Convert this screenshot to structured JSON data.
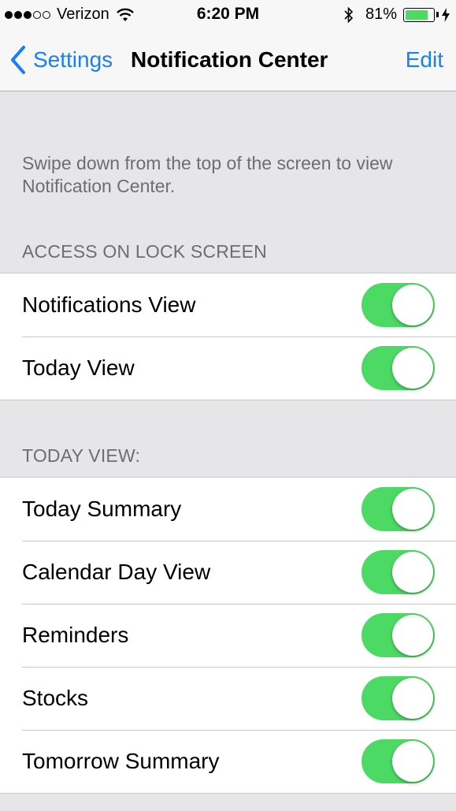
{
  "status_bar": {
    "signal_dots": [
      true,
      true,
      true,
      false,
      false
    ],
    "carrier": "Verizon",
    "time": "6:20 PM",
    "battery_percent_text": "81%",
    "battery_level": 0.81,
    "battery_color": "#4cd964"
  },
  "nav": {
    "back_label": "Settings",
    "title": "Notification Center",
    "edit_label": "Edit",
    "tint_color": "#1a7ff5"
  },
  "intro_text": "Swipe down from the top of the screen to view Notification Center.",
  "sections": [
    {
      "header": "ACCESS ON LOCK SCREEN",
      "rows": [
        {
          "label": "Notifications View",
          "on": true
        },
        {
          "label": "Today View",
          "on": true
        }
      ]
    },
    {
      "header": "TODAY VIEW:",
      "rows": [
        {
          "label": "Today Summary",
          "on": true
        },
        {
          "label": "Calendar Day View",
          "on": true
        },
        {
          "label": "Reminders",
          "on": true
        },
        {
          "label": "Stocks",
          "on": true
        },
        {
          "label": "Tomorrow Summary",
          "on": true
        }
      ]
    }
  ],
  "toggle_on_color": "#4cd964"
}
